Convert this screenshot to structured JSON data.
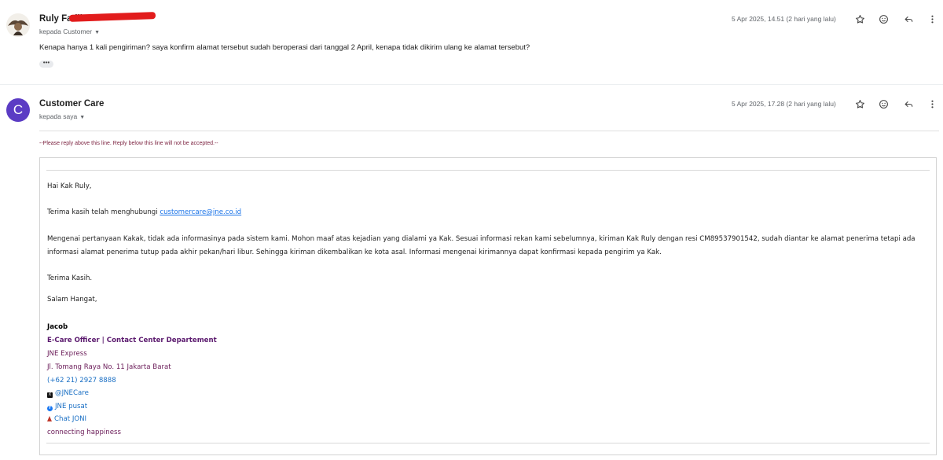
{
  "message1": {
    "sender": "Ruly Fadli",
    "to_label": "kepada Customer",
    "date": "5 Apr 2025, 14.51 (2 hari yang lalu)",
    "body": "Kenapa hanya 1 kali pengiriman? saya konfirm alamat tersebut sudah beroperasi dari tanggal 2 April, kenapa tidak dikirim ulang ke alamat tersebut?",
    "more": "•••"
  },
  "message2": {
    "avatar_letter": "C",
    "sender": "Customer Care",
    "to_label": "kepada saya",
    "date": "5 Apr 2025, 17.28 (2 hari yang lalu)",
    "notice": "--Please reply above this line. Reply below this line will not be accepted.--",
    "greeting": "Hai Kak Ruly,",
    "thanks_prefix": "Terima kasih telah menghubungi ",
    "thanks_link": "customercare@jne.co.id",
    "paragraph": "Mengenai pertanyaan Kakak, tidak ada informasinya pada sistem kami. Mohon maaf atas kejadian yang dialami ya Kak. Sesuai informasi rekan kami sebelumnya, kiriman Kak Ruly dengan resi CM89537901542, sudah diantar ke alamat penerima tetapi ada informasi alamat penerima tutup pada akhir pekan/hari libur. Sehingga kiriman dikembalikan ke kota asal. Informasi mengenai kirimannya dapat konfirmasi kepada pengirim ya Kak.",
    "closing1": "Terima Kasih.",
    "closing2": "Salam Hangat,",
    "signature": {
      "name": "Jacob",
      "title": "E-Care Officer | Contact Center Departement",
      "company": "JNE Express",
      "address": "Jl. Tomang Raya No. 11 Jakarta Barat",
      "phone": "(+62 21) 2927 8888",
      "twitter": "@JNECare",
      "facebook": "JNE pusat",
      "chat": "Chat JONI",
      "tagline": "connecting happiness"
    }
  },
  "icons": [
    "star-icon",
    "emoji-icon",
    "reply-icon",
    "more-vert-icon"
  ],
  "colors": {
    "avatar_bg": "#5b3cc4",
    "redaction": "#e21c1c",
    "link": "#1a73e8"
  }
}
